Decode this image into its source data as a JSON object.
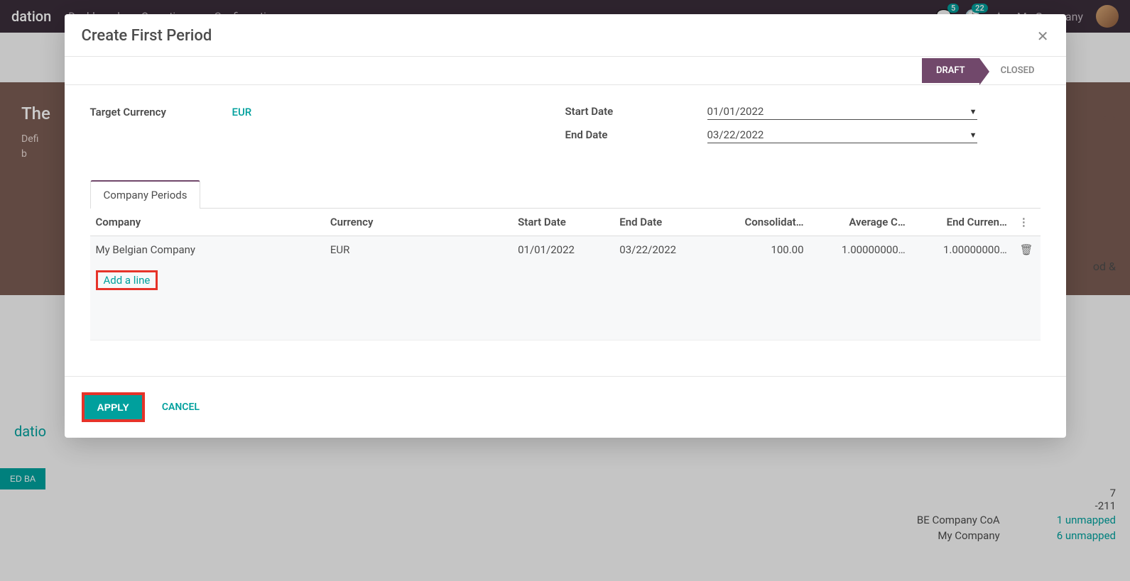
{
  "topnav": {
    "brand_suffix": "dation",
    "menu": [
      "Dashboard",
      "Operations",
      "Configuration"
    ],
    "badge1": "5",
    "badge2": "22",
    "company_label": "My Company"
  },
  "bg": {
    "hero_title_prefix": "The",
    "hero_line1_prefix": "Defi",
    "hero_line2_prefix": "b",
    "right_suffix": "od &",
    "brand_link": "datio",
    "teal_btn": "ED BA",
    "sum1": "7",
    "sum2": "-211",
    "unmap_rows": [
      {
        "company": "BE Company CoA",
        "status": "1 unmapped"
      },
      {
        "company": "My Company",
        "status": "6 unmapped"
      }
    ]
  },
  "modal": {
    "title": "Create First Period",
    "status": {
      "draft": "DRAFT",
      "closed": "CLOSED"
    },
    "fields": {
      "target_currency_label": "Target Currency",
      "target_currency_value": "EUR",
      "start_date_label": "Start Date",
      "start_date_value": "01/01/2022",
      "end_date_label": "End Date",
      "end_date_value": "03/22/2022"
    },
    "tab_label": "Company Periods",
    "table": {
      "headers": {
        "company": "Company",
        "currency": "Currency",
        "start": "Start Date",
        "end": "End Date",
        "consol": "Consolidat…",
        "avg": "Average C…",
        "endcur": "End Curren…"
      },
      "rows": [
        {
          "company": "My Belgian Company",
          "currency": "EUR",
          "start": "01/01/2022",
          "end": "03/22/2022",
          "consol": "100.00",
          "avg": "1.00000000…",
          "endcur": "1.00000000…"
        }
      ],
      "add_line": "Add a line"
    },
    "footer": {
      "apply": "APPLY",
      "cancel": "CANCEL"
    }
  }
}
